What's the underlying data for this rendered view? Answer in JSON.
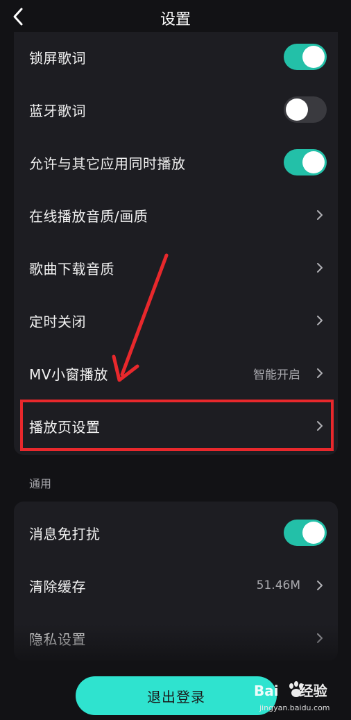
{
  "header": {
    "title": "设置"
  },
  "playback": {
    "items": [
      {
        "label": "锁屏歌词",
        "kind": "toggle",
        "on": true
      },
      {
        "label": "蓝牙歌词",
        "kind": "toggle",
        "on": false
      },
      {
        "label": "允许与其它应用同时播放",
        "kind": "toggle",
        "on": true
      },
      {
        "label": "在线播放音质/画质",
        "kind": "link"
      },
      {
        "label": "歌曲下载音质",
        "kind": "link"
      },
      {
        "label": "定时关闭",
        "kind": "link"
      },
      {
        "label": "MV小窗播放",
        "kind": "link",
        "value": "智能开启"
      },
      {
        "label": "播放页设置",
        "kind": "link"
      }
    ]
  },
  "general": {
    "section_label": "通用",
    "items": [
      {
        "label": "消息免打扰",
        "kind": "toggle",
        "on": true
      },
      {
        "label": "清除缓存",
        "kind": "link",
        "value": "51.46M"
      },
      {
        "label": "隐私设置",
        "kind": "link"
      }
    ]
  },
  "footer": {
    "logout_label": "退出登录"
  },
  "watermark": {
    "brand": "Bai",
    "brand_suffix": "经验",
    "url": "jingyan.baidu.com"
  },
  "colors": {
    "accent": "#23c0a8",
    "highlight": "#e8282c",
    "logout_bg": "#2fe3cf"
  }
}
